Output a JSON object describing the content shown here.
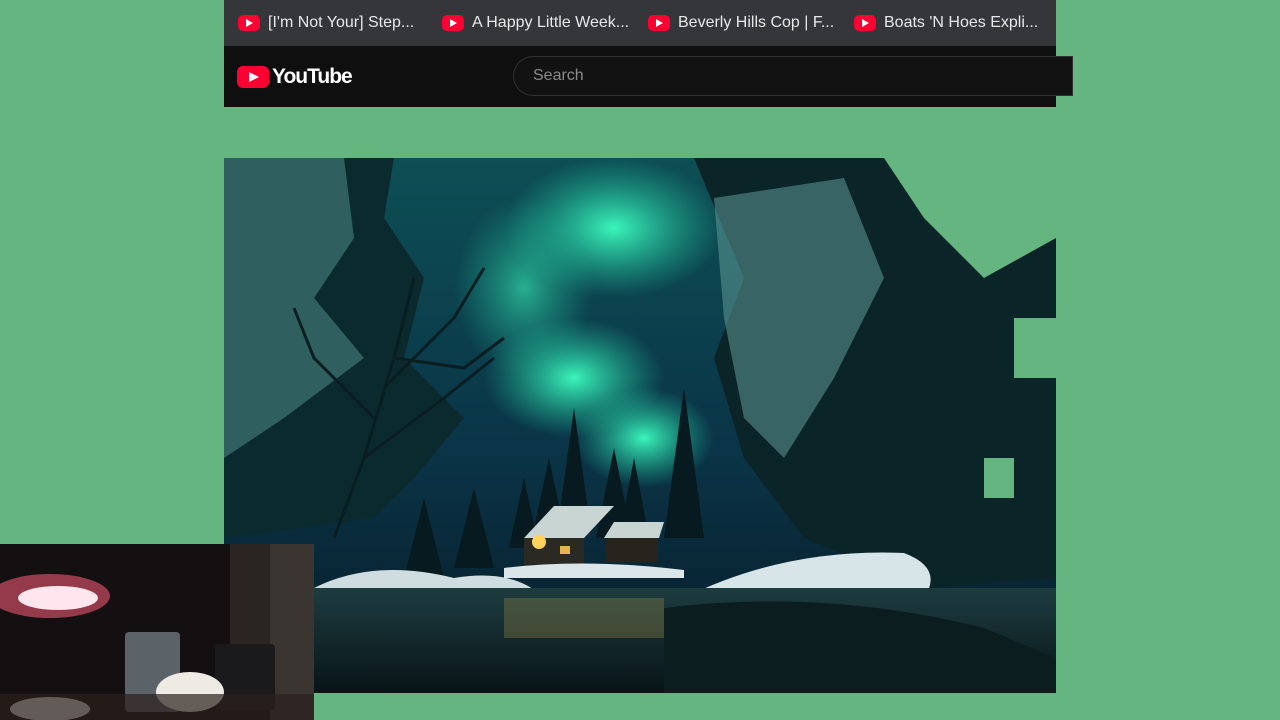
{
  "bookmarks": [
    {
      "label": "[I'm Not Your] Step...",
      "icon": "youtube-icon"
    },
    {
      "label": "A Happy Little Week...",
      "icon": "youtube-icon"
    },
    {
      "label": "Beverly Hills Cop | F...",
      "icon": "youtube-icon"
    },
    {
      "label": "Boats 'N Hoes Expli...",
      "icon": "youtube-icon"
    }
  ],
  "masthead": {
    "logo_text": "YouTube",
    "search_placeholder": "Search"
  },
  "colors": {
    "background": "#64b57f",
    "bookmark_bar": "#35363a",
    "masthead": "#0f0f0f",
    "youtube_red": "#ff0033",
    "aurora": "#2df0b4"
  }
}
